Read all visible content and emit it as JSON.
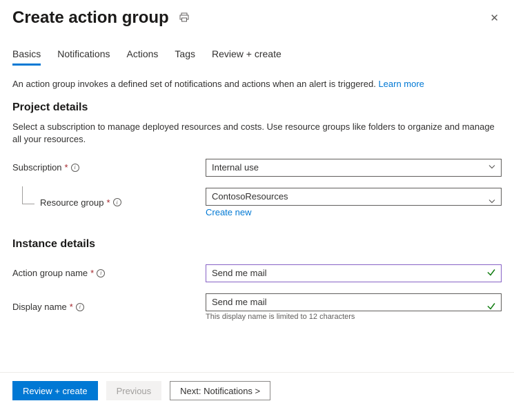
{
  "header": {
    "title": "Create action group"
  },
  "tabs": {
    "items": [
      {
        "label": "Basics",
        "active": true
      },
      {
        "label": "Notifications",
        "active": false
      },
      {
        "label": "Actions",
        "active": false
      },
      {
        "label": "Tags",
        "active": false
      },
      {
        "label": "Review + create",
        "active": false
      }
    ]
  },
  "intro": {
    "text": "An action group invokes a defined set of notifications and actions when an alert is triggered. ",
    "learn_more": "Learn more"
  },
  "project": {
    "title": "Project details",
    "desc": "Select a subscription to manage deployed resources and costs. Use resource groups like folders to organize and manage all your resources.",
    "subscription_label": "Subscription",
    "subscription_value": "Internal use",
    "resource_group_label": "Resource group",
    "resource_group_value": "ContosoResources",
    "create_new": "Create new"
  },
  "instance": {
    "title": "Instance details",
    "group_name_label": "Action group name",
    "group_name_value": "Send me mail",
    "display_name_label": "Display name",
    "display_name_value": "Send me mail",
    "display_name_helper": "This display name is limited to 12 characters"
  },
  "footer": {
    "review": "Review + create",
    "previous": "Previous",
    "next": "Next: Notifications >"
  }
}
